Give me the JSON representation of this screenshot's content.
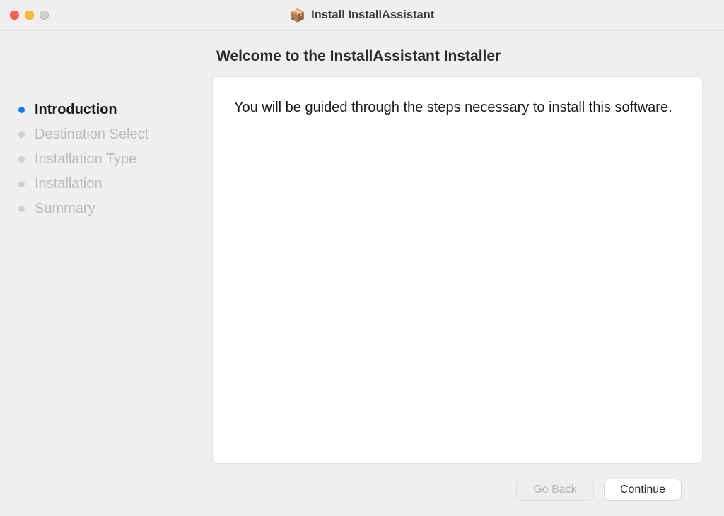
{
  "window": {
    "title": "Install InstallAssistant"
  },
  "main": {
    "heading": "Welcome to the InstallAssistant Installer",
    "body_text": "You will be guided through the steps necessary to install this software."
  },
  "sidebar": {
    "steps": [
      {
        "label": "Introduction",
        "active": true
      },
      {
        "label": "Destination Select",
        "active": false
      },
      {
        "label": "Installation Type",
        "active": false
      },
      {
        "label": "Installation",
        "active": false
      },
      {
        "label": "Summary",
        "active": false
      }
    ]
  },
  "footer": {
    "back_label": "Go Back",
    "continue_label": "Continue"
  }
}
